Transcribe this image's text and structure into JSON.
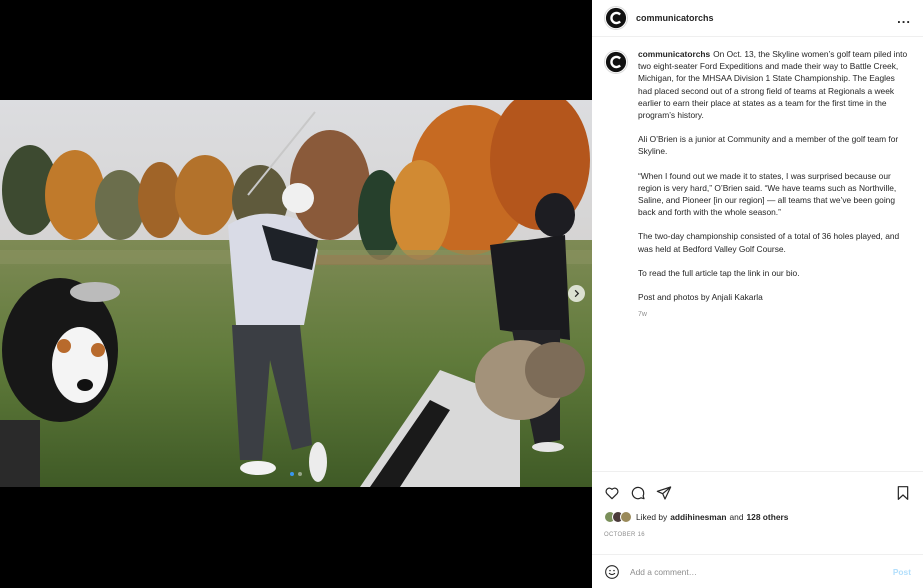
{
  "post": {
    "username": "communicatorchs",
    "more_label": "...",
    "caption_user": "communicatorchs",
    "caption_paragraphs": [
      "On Oct. 13, the Skyline women’s golf team piled into two eight-seater Ford Expeditions and made their way to Battle Creek, Michigan, for the MHSAA Division 1 State Championship. The Eagles had placed second out of a strong field of teams at Regionals a week earlier to earn their place at states as a team for the first time in the program’s history.",
      "Ali O’Brien is a junior at Community and a member of the golf team for Skyline.",
      "“When I found out we made it to states, I was surprised because our region is very hard,” O’Brien said. “We have teams such as Northville, Saline, and Pioneer [in our region] — all teams that we’ve been going back and forth with the whole season.”",
      "The two-day championship consisted of a total of 36 holes played, and was held at Bedford Valley Golf Course.",
      "To read the full article tap the link in our bio.",
      "Post and photos by Anjali Kakarla"
    ],
    "caption_time": "7w",
    "likes": {
      "prefix": "Liked by",
      "user": "addihinesman",
      "and": "and",
      "others": "128 others"
    },
    "date": "OCTOBER 16",
    "comment_placeholder": "Add a comment…",
    "post_label": "Post"
  },
  "carousel": {
    "slide_count": 2,
    "active_index": 0
  },
  "icons": {
    "like": "heart-icon",
    "comment": "comment-icon",
    "share": "paper-plane-icon",
    "save": "bookmark-icon",
    "emoji": "emoji-icon",
    "next": "chevron-right-icon",
    "avatar": "letter-c-logo"
  },
  "colors": {
    "link_blue": "#3897f0",
    "post_disabled": "#b2dffc",
    "muted": "#8e8e8e"
  }
}
